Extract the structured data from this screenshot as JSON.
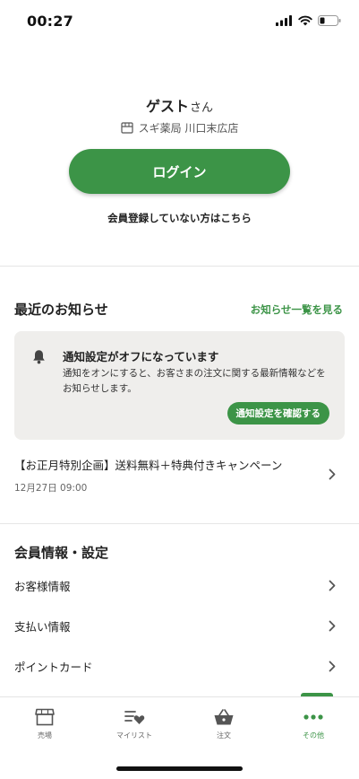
{
  "status_bar": {
    "time": "00:27"
  },
  "profile": {
    "name": "ゲスト",
    "suffix": "さん",
    "store": "スギ薬局 川口末広店"
  },
  "login": {
    "label": "ログイン",
    "register_link": "会員登録していない方はこちら"
  },
  "news": {
    "title": "最近のお知らせ",
    "view_all": "お知らせ一覧を見る",
    "notice": {
      "title": "通知設定がオフになっています",
      "text": "通知をオンにすると、お客さまの注文に関する最新情報などをお知らせします。",
      "button": "通知設定を確認する"
    },
    "items": [
      {
        "title": "【お正月特別企画】送料無料＋特典付きキャンペーン",
        "date": "12月27日 09:00"
      }
    ]
  },
  "settings": {
    "title": "会員情報・設定",
    "items": [
      {
        "label": "お客様情報"
      },
      {
        "label": "支払い情報"
      },
      {
        "label": "ポイントカード"
      }
    ]
  },
  "tab_bar": {
    "items": [
      {
        "label": "売場",
        "icon": "store-icon"
      },
      {
        "label": "マイリスト",
        "icon": "mylist-heart-icon"
      },
      {
        "label": "注文",
        "icon": "basket-icon"
      },
      {
        "label": "その他",
        "icon": "more-dots-icon"
      }
    ],
    "active": "その他"
  },
  "colors": {
    "accent": "#3c9447",
    "card_bg": "#efeeec",
    "text": "#222222"
  }
}
